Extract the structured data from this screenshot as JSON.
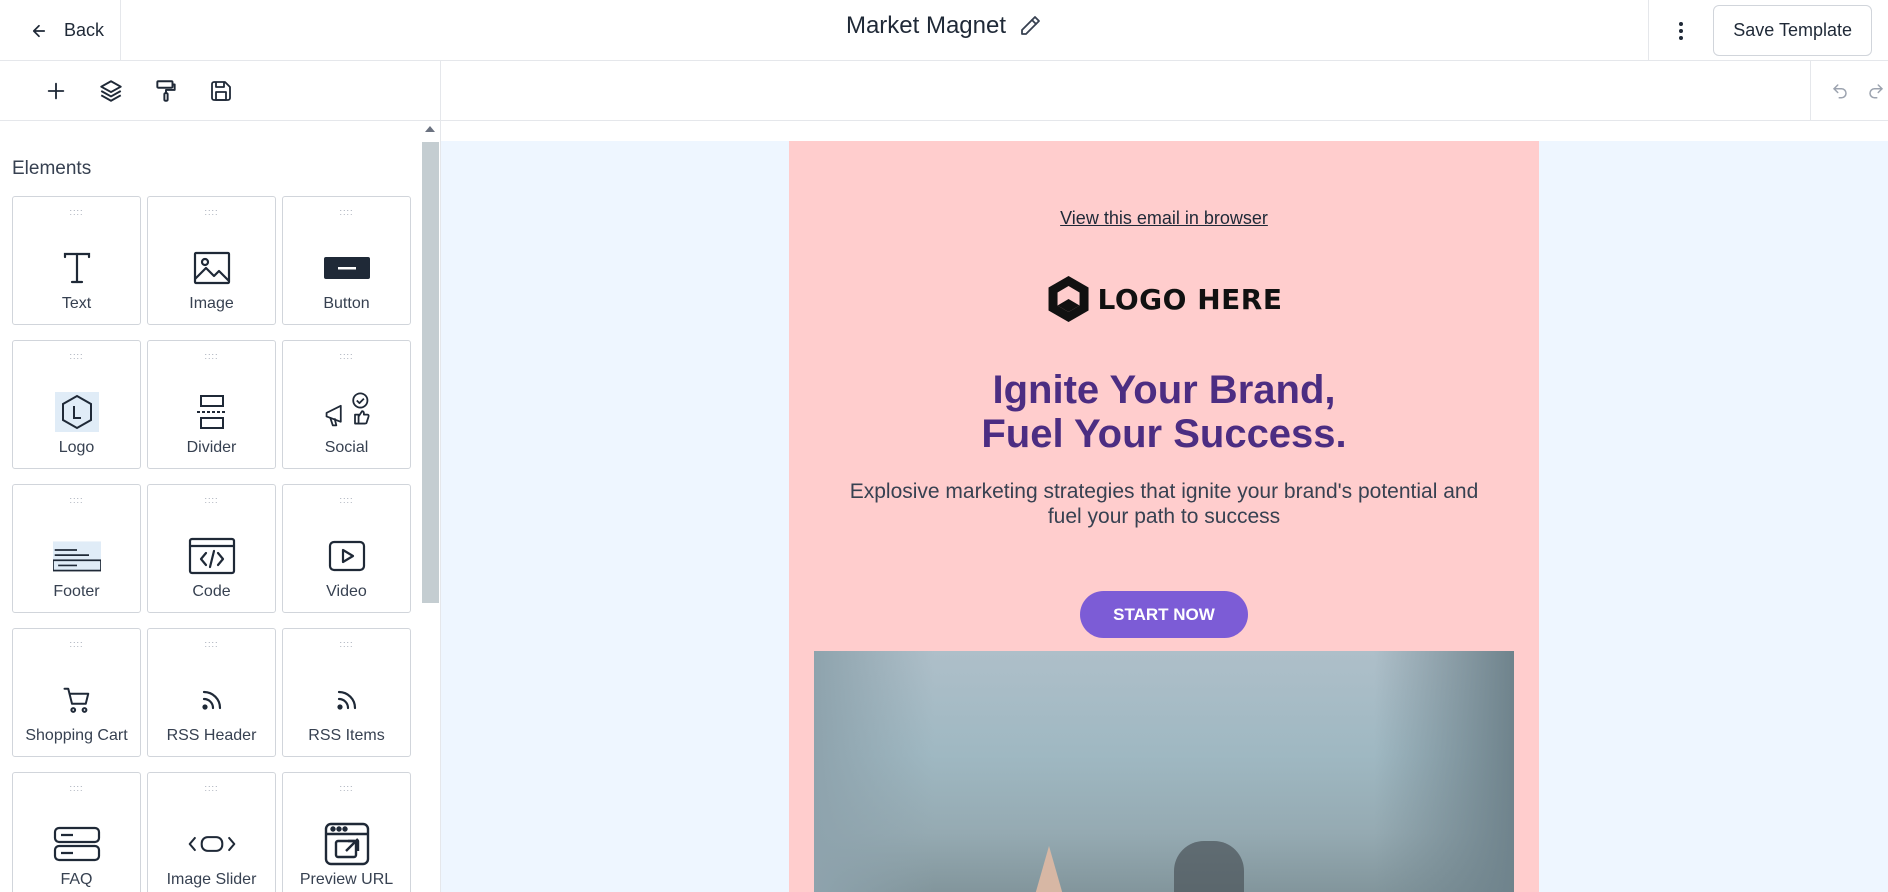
{
  "header": {
    "back_label": "Back",
    "title": "Market Magnet",
    "save_template_label": "Save Template"
  },
  "toolbar": {
    "tools": [
      "plus-icon",
      "layers-icon",
      "paint-roller-icon",
      "save-icon"
    ],
    "undo_redo": [
      "undo-icon",
      "redo-icon"
    ]
  },
  "sidebar": {
    "title": "Elements",
    "elements": [
      {
        "label": "Text",
        "icon": "text-icon"
      },
      {
        "label": "Image",
        "icon": "image-icon"
      },
      {
        "label": "Button",
        "icon": "button-icon"
      },
      {
        "label": "Logo",
        "icon": "logo-icon"
      },
      {
        "label": "Divider",
        "icon": "divider-icon"
      },
      {
        "label": "Social",
        "icon": "social-icon"
      },
      {
        "label": "Footer",
        "icon": "footer-icon"
      },
      {
        "label": "Code",
        "icon": "code-icon"
      },
      {
        "label": "Video",
        "icon": "video-icon"
      },
      {
        "label": "Shopping Cart",
        "icon": "shopping-cart-icon"
      },
      {
        "label": "RSS Header",
        "icon": "rss-icon"
      },
      {
        "label": "RSS Items",
        "icon": "rss-icon"
      },
      {
        "label": "FAQ",
        "icon": "faq-icon"
      },
      {
        "label": "Image Slider",
        "icon": "image-slider-icon"
      },
      {
        "label": "Preview URL",
        "icon": "preview-url-icon"
      }
    ]
  },
  "email": {
    "view_in_browser": "View this email in browser",
    "logo_text": "LOGO HERE",
    "headline_line1": "Ignite Your Brand,",
    "headline_line2": "Fuel Your Success.",
    "subtext": "Explosive marketing strategies that ignite your brand's potential and fuel your path to success",
    "cta_label": "START NOW",
    "colors": {
      "email_bg": "#ffcdcd",
      "canvas_bg": "#eef6ff",
      "headline": "#4c2d82",
      "cta": "#7c5cd6"
    }
  }
}
